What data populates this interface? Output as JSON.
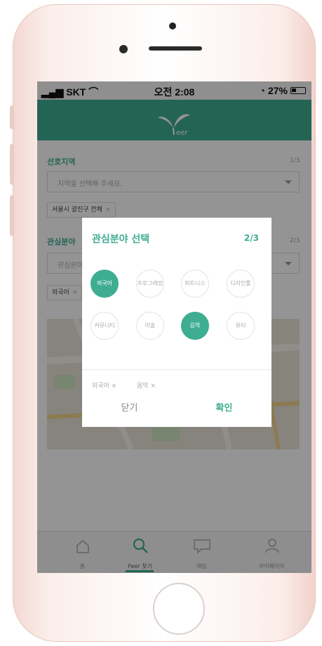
{
  "status": {
    "carrier": "SKT",
    "time": "오전 2:08",
    "battery": "27%"
  },
  "app": {
    "logo_text": "eer"
  },
  "form": {
    "region": {
      "label": "선호지역",
      "count": "1/3",
      "placeholder": "지역을 선택해 주세요.",
      "chip": "서울시 광진구 전체"
    },
    "interest": {
      "label": "관심분야",
      "count": "2/3",
      "placeholder": "관심분야 선택",
      "chip": "외국어"
    }
  },
  "modal": {
    "title": "관심분야 선택",
    "count": "2/3",
    "options": [
      {
        "label": "외국어",
        "selected": true
      },
      {
        "label": "프로그래밍",
        "selected": false
      },
      {
        "label": "피트니스",
        "selected": false
      },
      {
        "label": "디자인툴",
        "selected": false
      },
      {
        "label": "커뮤니티",
        "selected": false
      },
      {
        "label": "미술",
        "selected": false
      },
      {
        "label": "음악",
        "selected": true
      },
      {
        "label": "뷰티",
        "selected": false
      }
    ],
    "selected_chips": [
      "외국어 ×",
      "음악 ×"
    ],
    "close_label": "닫기",
    "ok_label": "확인"
  },
  "tabs": [
    {
      "label": "홈",
      "icon": "home-icon"
    },
    {
      "label": "Peer 찾기",
      "icon": "search-icon"
    },
    {
      "label": "채팅",
      "icon": "chat-icon"
    },
    {
      "label": "마이페이지",
      "icon": "person-icon"
    }
  ],
  "colors": {
    "accent": "#3fad92"
  }
}
